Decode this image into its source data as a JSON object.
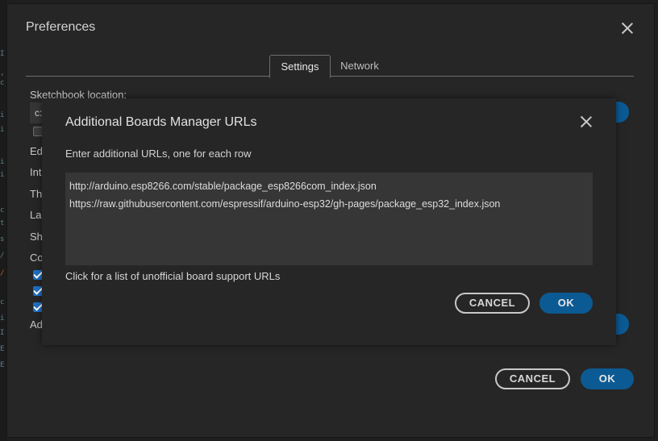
{
  "preferences": {
    "title": "Preferences",
    "tabs": [
      {
        "label": "Settings",
        "active": true
      },
      {
        "label": "Network",
        "active": false
      }
    ],
    "sketchbook_label": "Sketchbook location:",
    "sketchbook_value": "c:",
    "partial_labels": [
      "Ed",
      "Int",
      "Th",
      "La",
      "Sh",
      "Co",
      "Ad"
    ],
    "cancel_label": "CANCEL",
    "ok_label": "OK"
  },
  "modal": {
    "title": "Additional Boards Manager URLs",
    "description": "Enter additional URLs, one for each row",
    "urls": [
      "http://arduino.esp8266.com/stable/package_esp8266com_index.json",
      "https://raw.githubusercontent.com/espressif/arduino-esp32/gh-pages/package_esp32_index.json"
    ],
    "link_text": "Click for a list of unofficial board support URLs",
    "cancel_label": "CANCEL",
    "ok_label": "OK"
  },
  "colors": {
    "accent_blue": "#0c5a93",
    "checkbox_blue": "#1f6fc1",
    "background": "#262626"
  }
}
